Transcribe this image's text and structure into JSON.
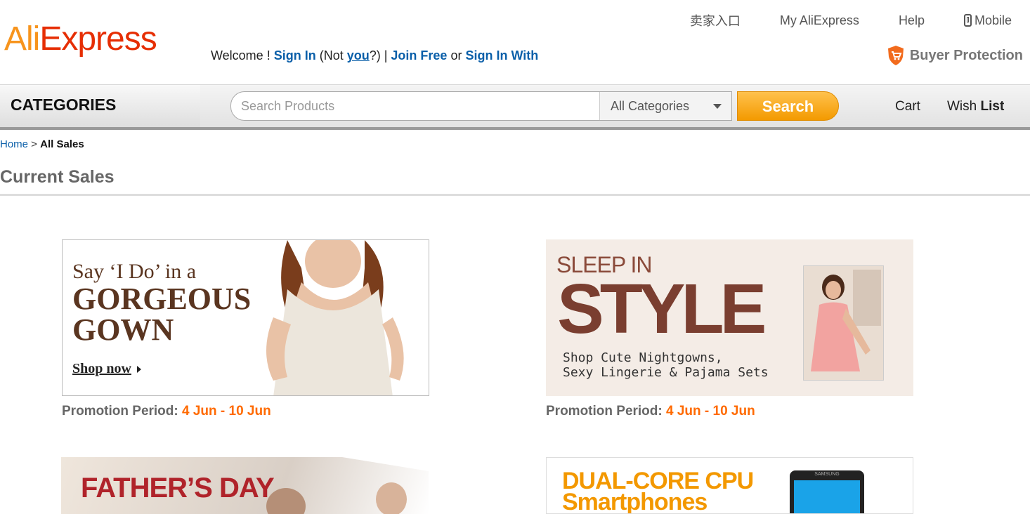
{
  "logo": {
    "part1": "Ali",
    "part2": "Express"
  },
  "top_links": {
    "seller": "卖家入口",
    "my_account": "My AliExpress",
    "help": "Help",
    "mobile": "Mobile"
  },
  "welcome": {
    "prefix": "Welcome ! ",
    "sign_in": "Sign In",
    "not_open": " (Not ",
    "you": "you",
    "not_close": "?) | ",
    "join": "Join Free",
    "or": " or ",
    "sign_in_with": "Sign In With"
  },
  "buyer_protection": "Buyer Protection",
  "catbar": {
    "categories_label": "CATEGORIES",
    "search_placeholder": "Search Products",
    "category_selected": "All Categories",
    "search_button": "Search",
    "cart": "Cart",
    "wish": "Wish ",
    "list": "List"
  },
  "breadcrumb": {
    "home": "Home",
    "separator": " > ",
    "current": "All Sales"
  },
  "page_title": "Current Sales",
  "sales": [
    {
      "line1": "Say ‘I Do’ in a",
      "line2": "GORGEOUS",
      "line3": "GOWN",
      "cta": "Shop now",
      "promo_label": "Promotion Period: ",
      "promo_dates": "4 Jun - 10 Jun"
    },
    {
      "line1": "SLEEP IN",
      "line2": "STYLE",
      "sub1": "Shop Cute Nightgowns,",
      "sub2": "Sexy Lingerie & Pajama Sets",
      "promo_label": "Promotion Period: ",
      "promo_dates": "4 Jun - 10 Jun"
    },
    {
      "line1": "FATHER’S DAY"
    },
    {
      "line1": "DUAL-CORE CPU",
      "line2": "Smartphones",
      "phone_brand": "SAMSUNG"
    }
  ],
  "colors": {
    "brand_orange": "#f7941d",
    "brand_red": "#e62e04",
    "link_blue": "#0a5fa9",
    "promo_orange": "#ff6a00"
  }
}
